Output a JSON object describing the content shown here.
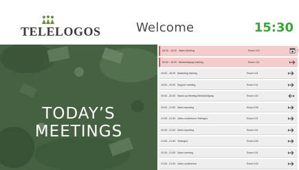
{
  "header": {
    "logo_text": "TELELOGOS",
    "welcome": "Welcome",
    "clock": "15:30"
  },
  "hero": {
    "line1": "TODAY’S",
    "line2": "MEETINGS"
  },
  "meetings": [
    {
      "time": "08:30 - 10:30",
      "title": "Sales Meeting",
      "room": "Room 103",
      "icon": "calendar-icon",
      "current": true
    },
    {
      "time": "09:00 - 10:00",
      "title": "Media4display training",
      "room": "Room 101",
      "icon": "arrow-right-icon",
      "current": true
    },
    {
      "time": "16:00 - 16:30",
      "title": "Marketing training",
      "room": "Room 101",
      "icon": "arrow-right-icon",
      "current": false
    },
    {
      "time": "18:00 - 20:00",
      "title": "Support meeting",
      "room": "Room 101",
      "icon": "arrow-right-icon",
      "current": false
    },
    {
      "time": "20:00 - 20:30",
      "title": "Stand-up Meeting Media4Display",
      "room": "Room 102",
      "icon": "arrow-left-icon",
      "current": false
    },
    {
      "time": "20:00 - 21:00",
      "title": "Sales reporting",
      "room": "Room 105",
      "icon": "arrow-right-icon",
      "current": false
    },
    {
      "time": "21:00 - 21:30",
      "title": "Video conference Telelogos",
      "room": "Room 101",
      "icon": "arrow-right-icon",
      "current": false
    },
    {
      "time": "20:30 - 21:00",
      "title": "Sales reporting",
      "room": "Room 101",
      "icon": "arrow-right-icon",
      "current": false
    },
    {
      "time": "21:00 - 21:30",
      "title": "Telelogos",
      "room": "Room 105",
      "icon": "arrow-right-icon",
      "current": false
    },
    {
      "time": "20:30 - 21:00",
      "title": "Sales meeting",
      "room": "Room 101",
      "icon": "arrow-right-icon",
      "current": false
    },
    {
      "time": "21:00 - 21:30",
      "title": "Video conference",
      "room": "Room 104",
      "icon": "arrow-right-icon",
      "current": false
    }
  ]
}
